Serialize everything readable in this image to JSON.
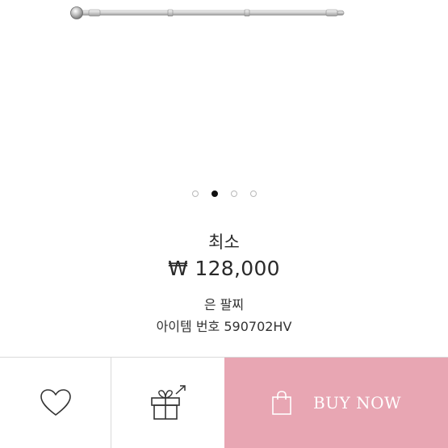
{
  "product": {
    "price_label": "최소",
    "price": "₩ 128,000",
    "material": "은 팔찌",
    "item_number": "아이템 번호 590702HV",
    "image_icon": "silver-bracelet-image"
  },
  "carousel": {
    "slide_count": 4,
    "active_index": 1
  },
  "actions": {
    "wishlist_icon": "heart-icon",
    "gift_icon": "gift-icon",
    "bag_icon": "shopping-bag-icon",
    "buy_label": "BUY NOW",
    "buy_color": "#e8a6b3"
  }
}
